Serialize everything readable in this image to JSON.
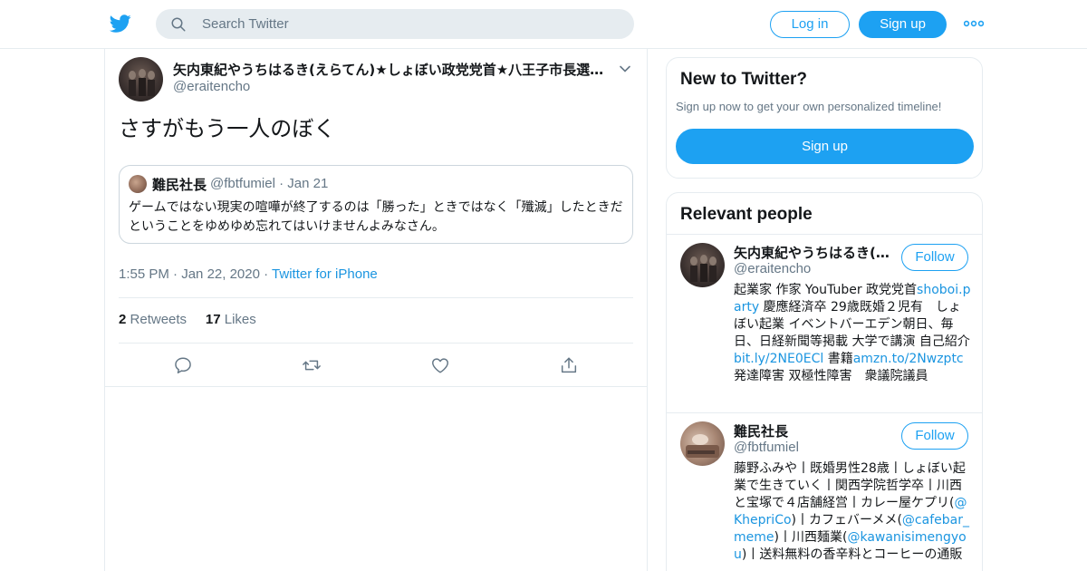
{
  "header": {
    "search_placeholder": "Search Twitter",
    "login_label": "Log in",
    "signup_label": "Sign up"
  },
  "tweet": {
    "author_name": "矢内東紀やうちはるき(えらてん)★しょぼい政党党首★八王子市長選…",
    "author_handle": "@eraitencho",
    "text": "さすがもう一人のぼく",
    "quoted": {
      "name": "難民社長",
      "handle": "@fbtfumiel",
      "date": "Jan 21",
      "text": "ゲームではない現実の喧嘩が終了するのは「勝った」ときではなく「殲滅」したときだということをゆめゆめ忘れてはいけませんよみなさん。"
    },
    "time": "1:55 PM",
    "date": "Jan 22, 2020",
    "source": "Twitter for iPhone",
    "retweets_count": "2",
    "retweets_label": "Retweets",
    "likes_count": "17",
    "likes_label": "Likes"
  },
  "sidebar": {
    "new_card": {
      "title": "New to Twitter?",
      "subtitle": "Sign up now to get your own personalized timeline!",
      "button": "Sign up"
    },
    "relevant": {
      "title": "Relevant people",
      "follow_label": "Follow",
      "people": [
        {
          "name": "矢内東紀やうちはるき(…",
          "handle": "@eraitencho",
          "bio": [
            {
              "t": "起業家 作家 YouTuber 政党党首",
              "link": false
            },
            {
              "t": "shoboi.party",
              "link": true
            },
            {
              "t": " 慶應経済卒 29歳既婚２児有　しょぼい起業 イベントバーエデン朝日、毎日、日経新聞等掲載 大学で講演 自己紹介",
              "link": false
            },
            {
              "t": "bit.ly/2NE0ECl",
              "link": true
            },
            {
              "t": " 書籍",
              "link": false
            },
            {
              "t": "amzn.to/2Nwzptc",
              "link": true
            },
            {
              "t": " 発達障害 双極性障害　衆議院議員",
              "link": false
            }
          ]
        },
        {
          "name": "難民社長",
          "handle": "@fbtfumiel",
          "bio": [
            {
              "t": "藤野ふみや丨既婚男性28歳丨しょぼい起業で生きていく丨関西学院哲学卒丨川西と宝塚で４店舗経営丨カレー屋ケプリ(",
              "link": false
            },
            {
              "t": "@KhepriCo",
              "link": true
            },
            {
              "t": ")丨カフェバーメメ(",
              "link": false
            },
            {
              "t": "@cafebar_meme",
              "link": true
            },
            {
              "t": ")丨川西麺業(",
              "link": false
            },
            {
              "t": "@kawanisimengyou",
              "link": true
            },
            {
              "t": ")丨送料無料の香辛料とコーヒーの通販",
              "link": false
            }
          ]
        }
      ]
    }
  },
  "colors": {
    "accent": "#1da1f2",
    "link": "#1b95e0",
    "muted": "#657786",
    "border": "#e6ecf0"
  },
  "icons": [
    "twitter-bird-icon",
    "search-icon",
    "more-dots-icon",
    "chevron-down-icon",
    "reply-icon",
    "retweet-icon",
    "like-icon",
    "share-icon"
  ]
}
